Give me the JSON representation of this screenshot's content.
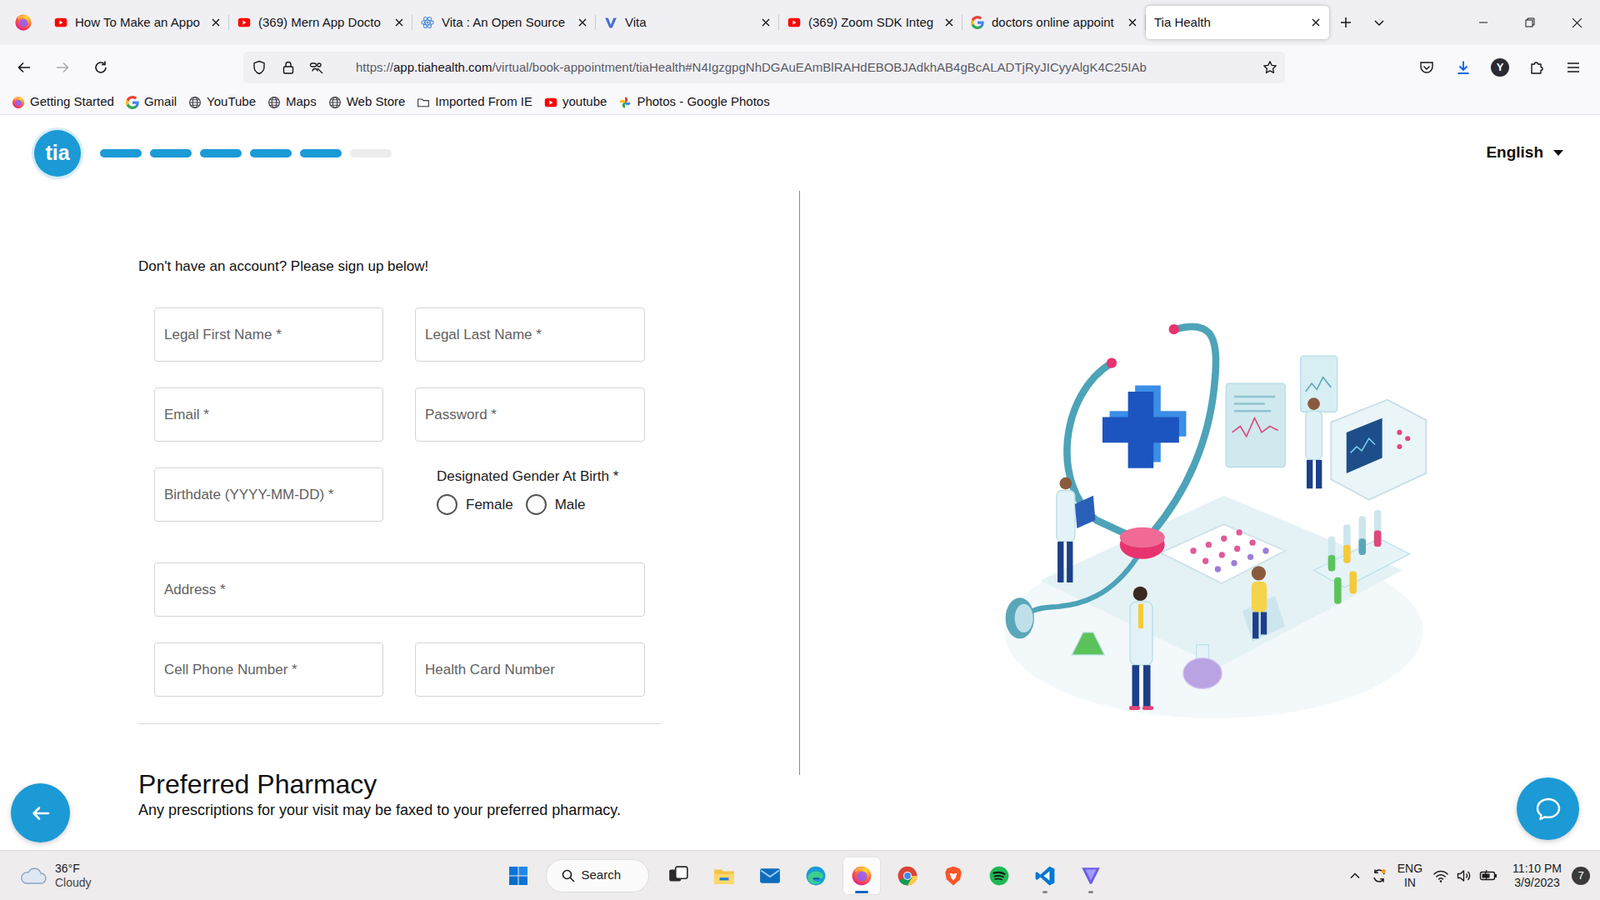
{
  "browser": {
    "tabs": [
      {
        "label": "How To Make an Appo",
        "selected": false
      },
      {
        "label": "(369) Mern App Docto",
        "selected": false
      },
      {
        "label": "Vita : An Open Source",
        "selected": false
      },
      {
        "label": "Vita",
        "selected": false
      },
      {
        "label": "(369) Zoom SDK Integ",
        "selected": false
      },
      {
        "label": "doctors online appoint",
        "selected": false
      },
      {
        "label": "Tia Health",
        "selected": true
      }
    ],
    "address": {
      "scheme": "https://",
      "host": "app.tiahealth.com",
      "path": "/virtual/book-appointment/tiaHealth#N4IgzgpgNhDGAuEAmBlRAHdEBOBJAdkhAB4gBcALADTjRyJICyyAlgK4C25IAb"
    },
    "account": "Y",
    "bookmarks": [
      "Getting Started",
      "Gmail",
      "YouTube",
      "Maps",
      "Web Store",
      "Imported From IE",
      "youtube",
      "Photos - Google Photos"
    ]
  },
  "page": {
    "logo": "tia",
    "steps": [
      {
        "done": true
      },
      {
        "done": true
      },
      {
        "done": true
      },
      {
        "done": true
      },
      {
        "done": true
      },
      {
        "done": false
      }
    ],
    "language": "English",
    "intro": "Don't have an account? Please sign up below!",
    "fields": {
      "first_name": "Legal First Name *",
      "last_name": "Legal Last Name *",
      "email": "Email *",
      "password": "Password *",
      "birthdate": "Birthdate (YYYY-MM-DD) *",
      "address": "Address *",
      "phone": "Cell Phone Number *",
      "health_card": "Health Card Number"
    },
    "gender": {
      "label": "Designated Gender At Birth *",
      "options": [
        {
          "label": "Female",
          "selected": false
        },
        {
          "label": "Male",
          "selected": false
        }
      ]
    },
    "pharmacy": {
      "title": "Preferred Pharmacy",
      "text": "Any prescriptions for your visit may be faxed to your preferred pharmacy."
    }
  },
  "taskbar": {
    "weather": {
      "temp": "36°F",
      "condition": "Cloudy"
    },
    "search": "Search",
    "apps": [
      {
        "running": false,
        "selected": false
      },
      {
        "running": false,
        "selected": false
      },
      {
        "running": false,
        "selected": false
      },
      {
        "running": false,
        "selected": false
      },
      {
        "running": true,
        "selected": true
      },
      {
        "running": false,
        "selected": false
      },
      {
        "running": false,
        "selected": false
      },
      {
        "running": false,
        "selected": false
      },
      {
        "running": true,
        "selected": false
      },
      {
        "running": true,
        "selected": false
      }
    ],
    "input_language": {
      "lang": "ENG",
      "region": "IN"
    },
    "time": "11:10 PM",
    "date": "3/9/2023",
    "notifications": "7"
  }
}
